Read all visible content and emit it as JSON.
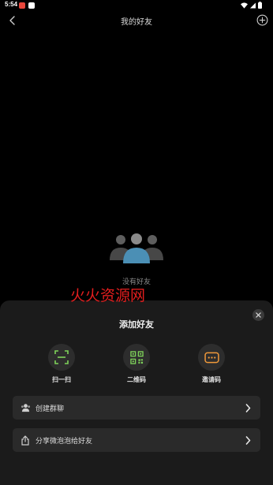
{
  "status_bar": {
    "time": "5:54"
  },
  "nav": {
    "title": "我的好友"
  },
  "empty_state": {
    "message": "没有好友"
  },
  "watermark": {
    "text": "火火资源网"
  },
  "sheet": {
    "title": "添加好友",
    "actions": [
      {
        "label": "扫一扫",
        "icon": "scan-icon",
        "color": "#7fd35a"
      },
      {
        "label": "二维码",
        "icon": "qr-code-icon",
        "color": "#7fd35a"
      },
      {
        "label": "邀请码",
        "icon": "invite-code-icon",
        "color": "#f0993a"
      }
    ],
    "rows": [
      {
        "label": "创建群聊",
        "icon": "group-icon"
      },
      {
        "label": "分享微泡泡给好友",
        "icon": "share-icon"
      }
    ]
  }
}
